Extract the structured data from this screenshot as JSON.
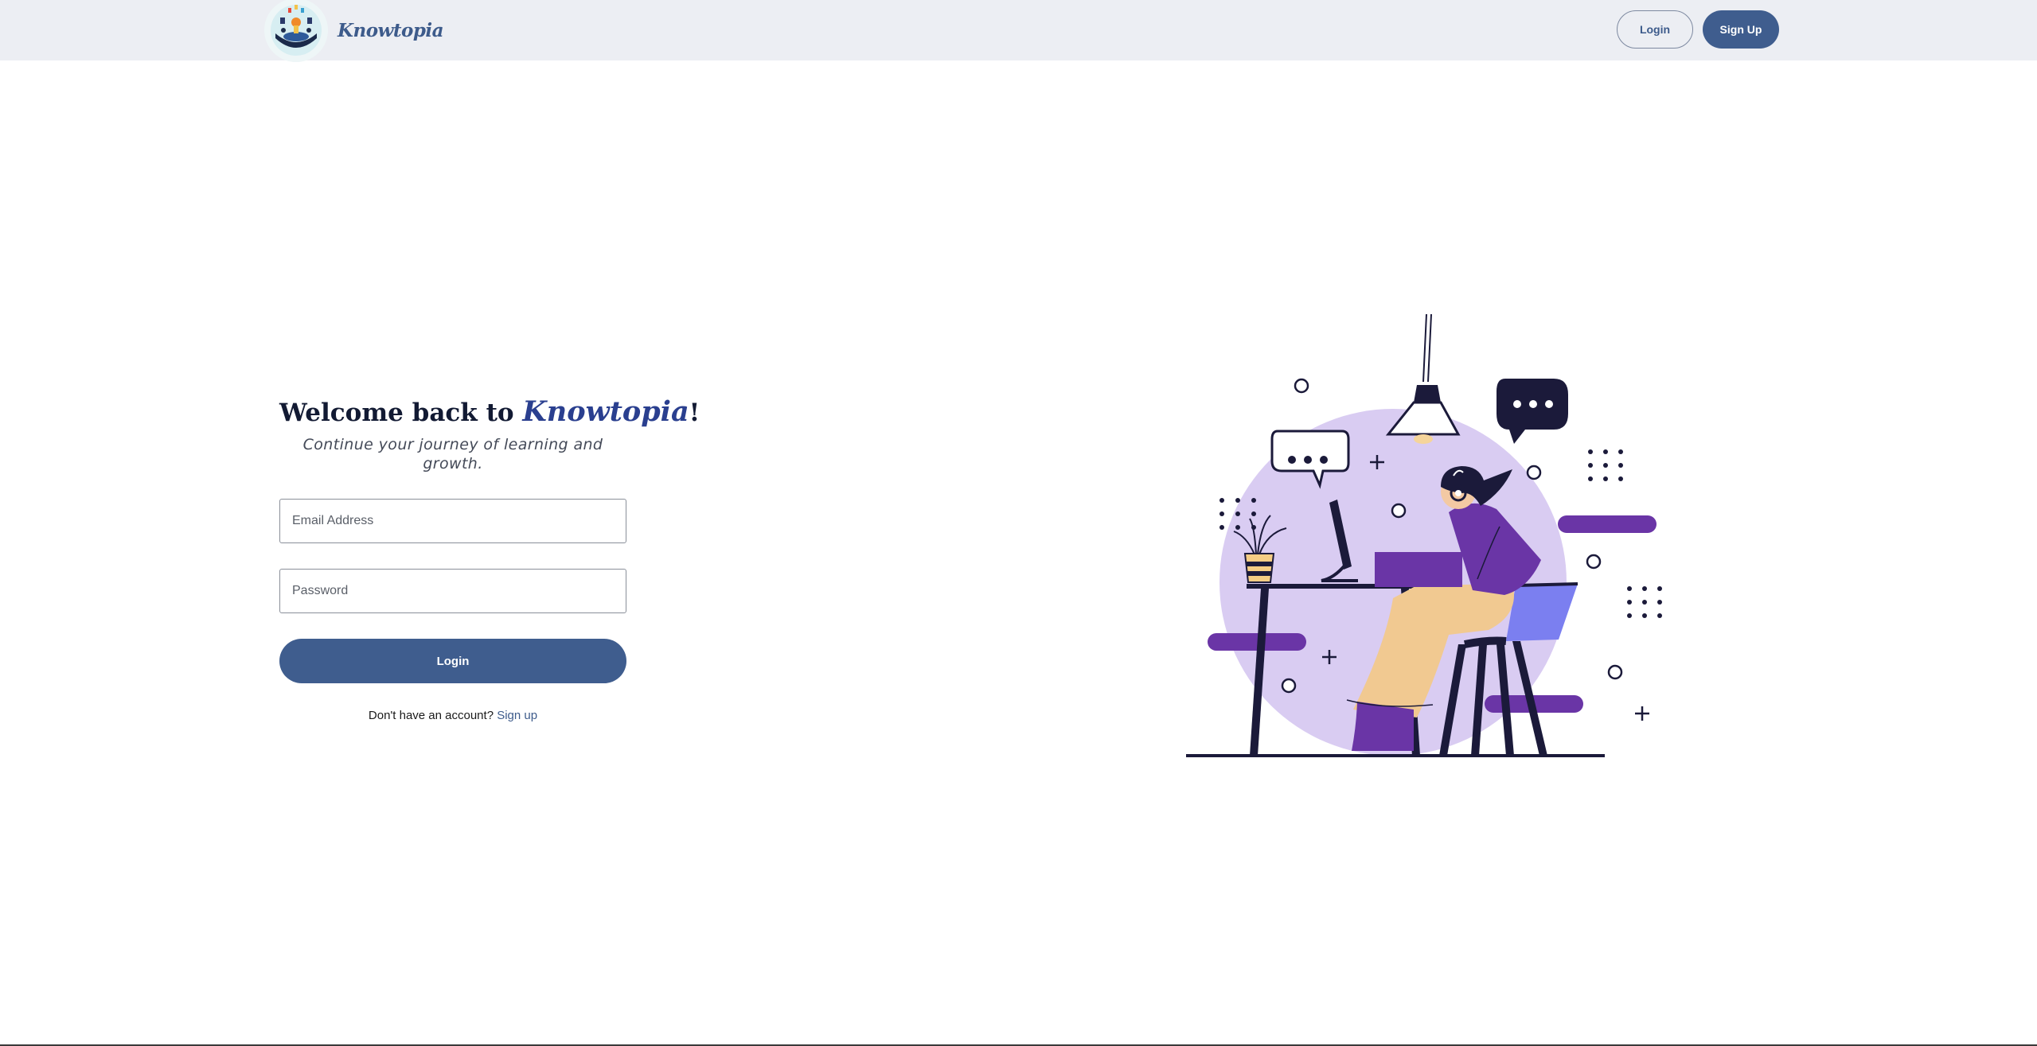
{
  "navbar": {
    "brand_name": "Knowtopia",
    "login_label": "Login",
    "signup_label": "Sign Up"
  },
  "login": {
    "welcome_prefix": "Welcome back to ",
    "welcome_brand": "Knowtopia",
    "welcome_suffix": "!",
    "subtitle": "Continue your journey of learning and growth.",
    "email_placeholder": "Email Address",
    "password_placeholder": "Password",
    "login_button": "Login",
    "no_account_text": "Don't have an account?",
    "signup_link": "Sign up"
  },
  "colors": {
    "primary": "#3f5d8e",
    "navbar_bg": "#eceef3",
    "illustration_purple": "#6a35a6",
    "illustration_lavender": "#d9ccf2",
    "illustration_navy": "#1b1a3a"
  },
  "icons": {
    "logo": "knowtopia-logo",
    "illustration": "person-at-desk-illustration"
  }
}
